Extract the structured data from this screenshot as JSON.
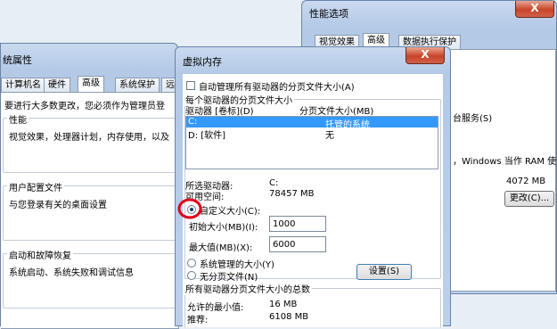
{
  "perf_window": {
    "title": "性能选项",
    "close": "X",
    "tabs": [
      "视觉效果",
      "高级",
      "数据执行保护"
    ],
    "service_text": "台服务(S)",
    "memory_note": "，Windows 当作 RAM 使",
    "memory_size": "4072 MB",
    "change_button": "更改(C)..."
  },
  "sys_window": {
    "title": "统属性",
    "tabs": [
      "计算机名",
      "硬件",
      "高级",
      "系统保护",
      "远"
    ],
    "admin_note": "要进行大多数更改，您必须作为管理员登",
    "performance": {
      "title": "性能",
      "desc": "视觉效果，处理器计划，内存使用，以及"
    },
    "user_profile": {
      "title": "用户配置文件",
      "desc": "与您登录有关的桌面设置"
    },
    "startup": {
      "title": "启动和故障恢复",
      "desc": "系统启动、系统失败和调试信息"
    }
  },
  "vm_dialog": {
    "title": "虚拟内存",
    "close": "X",
    "auto_manage": "自动管理所有驱动器的分页文件大小(A)",
    "per_drive_title": "每个驱动器的分页文件大小",
    "col_drive": "驱动器 [卷标](D)",
    "col_size": "分页文件大小(MB)",
    "drives": [
      {
        "drive": "C:",
        "size": "托管的系统",
        "selected": true
      },
      {
        "drive": "D:    [软件]",
        "size": "无",
        "selected": false
      }
    ],
    "selected_drive_label": "所选驱动器:",
    "selected_drive_value": "C:",
    "free_space_label": "可用空间:",
    "free_space_value": "78457 MB",
    "custom_size": "自定义大小(C):",
    "initial_label": "初始大小(MB)(I):",
    "initial_value": "1000",
    "max_label": "最大值(MB)(X):",
    "max_value": "6000",
    "system_managed": "系统管理的大小(Y)",
    "no_paging": "无分页文件(N)",
    "set_button": "设置(S)",
    "total_title": "所有驱动器分页文件大小的总数",
    "min_allowed_label": "允许的最小值:",
    "min_allowed_value": "16 MB",
    "recommended_label": "推荐:",
    "recommended_value": "6108 MB",
    "custom_selected": true,
    "highlight_color": "#e0001a",
    "selection_color": "#3399ff"
  }
}
